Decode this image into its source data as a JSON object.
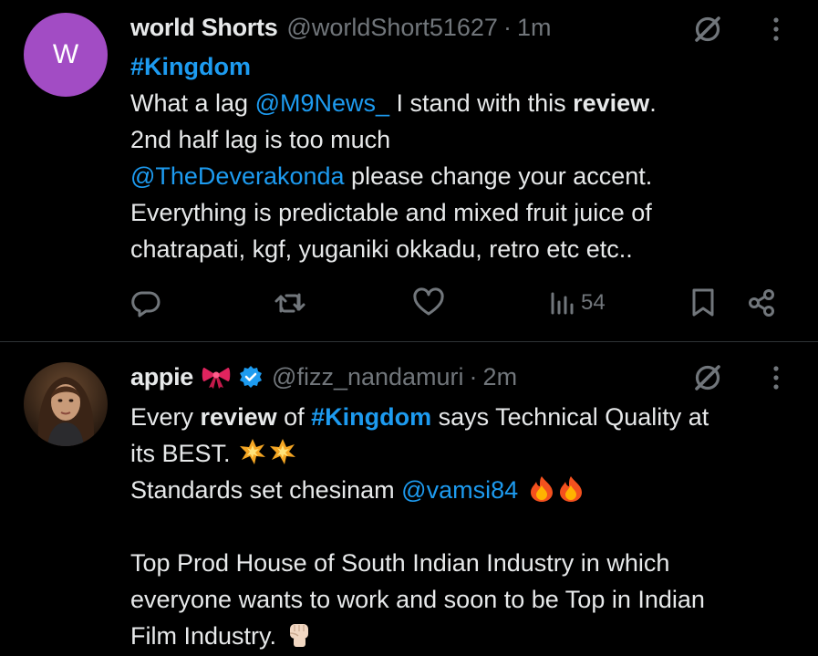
{
  "tweets": [
    {
      "avatar_letter": "W",
      "avatar_color": "#a24cc4",
      "name": "world Shorts",
      "handle": "@worldShort51627",
      "separator": "·",
      "time": "1m",
      "lines": [
        {
          "hashtag": "#Kingdom"
        },
        {
          "t1": "What a lag ",
          "mention": "@M9News_",
          "t2": " I stand with this ",
          "bold": "review",
          "t3": "."
        },
        {
          "text": "2nd half lag is too much"
        },
        {
          "mention": "@TheDeverakonda",
          "text": " please change your accent."
        },
        {
          "text": "Everything is predictable and mixed fruit juice of"
        },
        {
          "text": "chatrapati, kgf, yuganiki okkadu, retro etc etc.."
        }
      ],
      "views": "54",
      "icons": [
        "grok-icon",
        "more-icon",
        "reply-icon",
        "retweet-icon",
        "like-icon",
        "views-icon",
        "bookmark-icon",
        "share-icon"
      ]
    },
    {
      "avatar_icon": "profile-photo",
      "name": "appie",
      "name_emoji": "ribbon-bow-icon",
      "verified": "verified-badge-icon",
      "handle": "@fizz_nandamuri",
      "separator": "·",
      "time": "2m",
      "lines": [
        {
          "t1": "Every ",
          "bold": "review",
          "t2": " of ",
          "hashtag": "#Kingdom",
          "t3": " says Technical Quality at"
        },
        {
          "text": "its BEST.",
          "emoji": "collision-icon"
        },
        {
          "text": "Standards set chesinam ",
          "mention": "@vamsi84",
          "emoji": "fire-icon"
        },
        {
          "text": ""
        },
        {
          "text": "Top Prod House of South Indian Industry in which"
        },
        {
          "text": "everyone wants to work and soon to be Top in Indian"
        },
        {
          "text": "Film Industry.",
          "emoji": "raised-fist-icon"
        }
      ]
    }
  ],
  "colors": {
    "background": "#000000",
    "text": "#e7e9ea",
    "muted": "#71767b",
    "link": "#1d9bf0",
    "divider": "#2f3336",
    "verified": "#1d9bf0"
  }
}
